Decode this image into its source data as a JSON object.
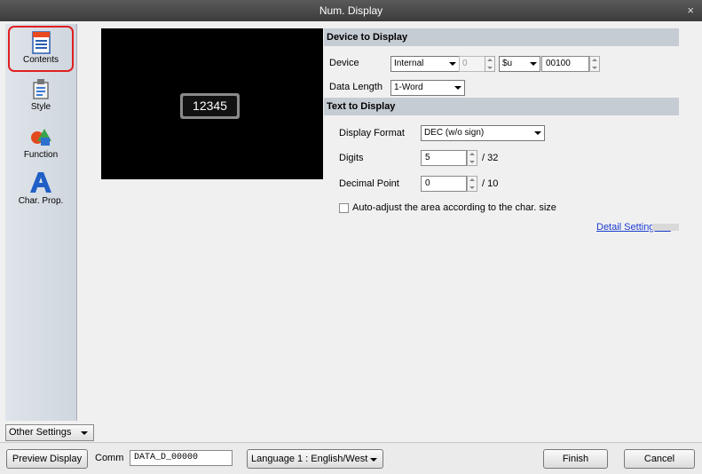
{
  "window": {
    "title": "Num. Display",
    "close_glyph": "×"
  },
  "sidebar": {
    "items": [
      {
        "label": "Contents",
        "icon": "contents-icon",
        "selected": true
      },
      {
        "label": "Style",
        "icon": "style-icon"
      },
      {
        "label": "Function",
        "icon": "function-icon"
      },
      {
        "label": "Char. Prop.",
        "icon": "char-prop-icon"
      }
    ],
    "other_settings": "Other Settings"
  },
  "preview": {
    "value": "12345"
  },
  "device_section": {
    "header": "Device to Display",
    "device_label": "Device",
    "device_type": "Internal",
    "device_index": "0",
    "device_prefix": "$u",
    "device_address": "00100",
    "data_length_label": "Data Length",
    "data_length": "1-Word"
  },
  "text_section": {
    "header": "Text to Display",
    "display_format_label": "Display Format",
    "display_format": "DEC (w/o sign)",
    "digits_label": "Digits",
    "digits": "5",
    "digits_max": "/ 32",
    "decimal_label": "Decimal Point",
    "decimal": "0",
    "decimal_max": "/ 10",
    "auto_adjust": "Auto-adjust the area according to the char. size",
    "detail_link": "Detail Settings>>"
  },
  "bottom": {
    "preview_btn": "Preview Display",
    "comm_label": "Comm",
    "comm_value": "DATA_D_00000",
    "language": "Language 1 : English/West",
    "finish": "Finish",
    "cancel": "Cancel"
  },
  "colors": {
    "accent_red": "#e02020",
    "section_header": "#c6ccd4",
    "link": "#1a3ccf"
  }
}
